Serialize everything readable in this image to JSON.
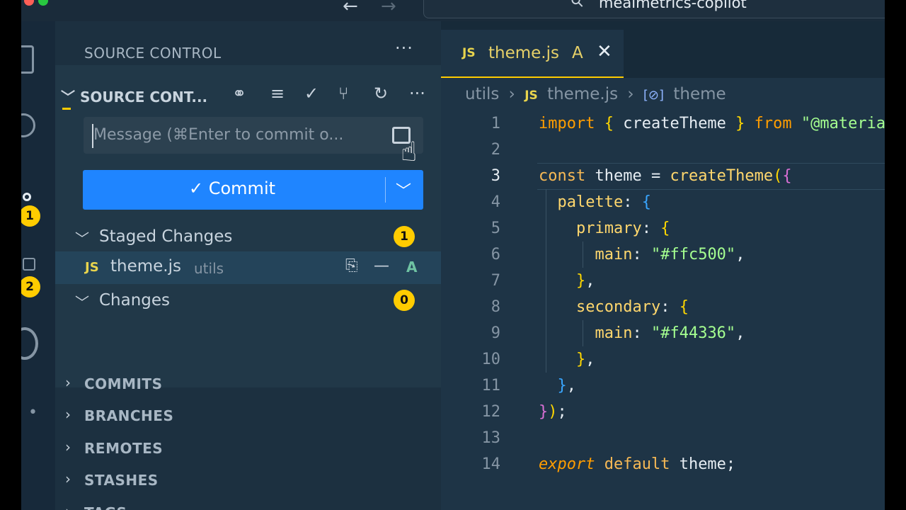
{
  "window": {
    "title": "mealmetrics-copilot",
    "nav_back": "←",
    "nav_forward": "→"
  },
  "activity_bar": {
    "scm_badge": "1",
    "run_badge": "2",
    "more": "•"
  },
  "sidebar": {
    "header": "SOURCE CONTROL",
    "header_more": "···",
    "scm_section_title": "SOURCE CONT...",
    "message_placeholder": "Message (⌘Enter to commit o...",
    "commit_label": "✓ Commit",
    "staged": {
      "label": "Staged Changes",
      "count": "1"
    },
    "staged_file": {
      "icon": "JS",
      "name": "theme.js",
      "dir": "utils",
      "status": "A"
    },
    "changes": {
      "label": "Changes",
      "count": "0"
    },
    "panels": [
      "COMMITS",
      "BRANCHES",
      "REMOTES",
      "STASHES",
      "TAGS"
    ]
  },
  "editor": {
    "tab": {
      "icon": "JS",
      "name": "theme.js",
      "status": "A",
      "close": "✕"
    },
    "breadcrumb": {
      "folder": "utils",
      "sep": "›",
      "file_icon": "JS",
      "file": "theme.js",
      "symbol_icon": "[⊘]",
      "symbol": "theme"
    },
    "line_numbers": [
      "1",
      "2",
      "3",
      "4",
      "5",
      "6",
      "7",
      "8",
      "9",
      "10",
      "11",
      "12",
      "13",
      "14"
    ]
  },
  "colors": {
    "accent": "#1f85ff",
    "badge": "#ffcc00",
    "sidebar_bg": "#1c3040",
    "editor_bg": "#1e3446"
  }
}
